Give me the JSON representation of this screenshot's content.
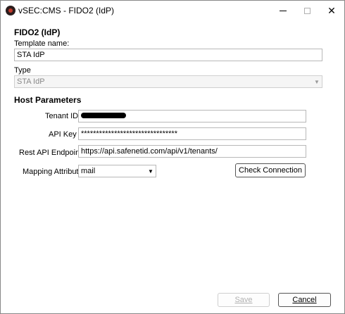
{
  "window": {
    "title": "vSEC:CMS - FIDO2 (IdP)",
    "minimize_glyph": "—",
    "maximize_glyph": "☐",
    "close_glyph": "✕"
  },
  "form": {
    "heading": "FIDO2 (IdP)",
    "template_name_label": "Template name:",
    "template_name_value": "STA IdP",
    "type_label": "Type",
    "type_value": "STA IdP"
  },
  "host": {
    "section_title": "Host Parameters",
    "tenant_id_label": "Tenant ID",
    "api_key_label": "API Key",
    "api_key_value": "********************************",
    "endpoint_label": "Rest API Endpoint",
    "endpoint_value": "https://api.safenetid.com/api/v1/tenants/",
    "mapping_label": "Mapping Attribute",
    "mapping_value": "mail",
    "check_connection_label": "Check Connection"
  },
  "footer": {
    "save_label": "Save",
    "cancel_label": "Cancel"
  },
  "icons": {
    "combo_arrow": "▼"
  }
}
